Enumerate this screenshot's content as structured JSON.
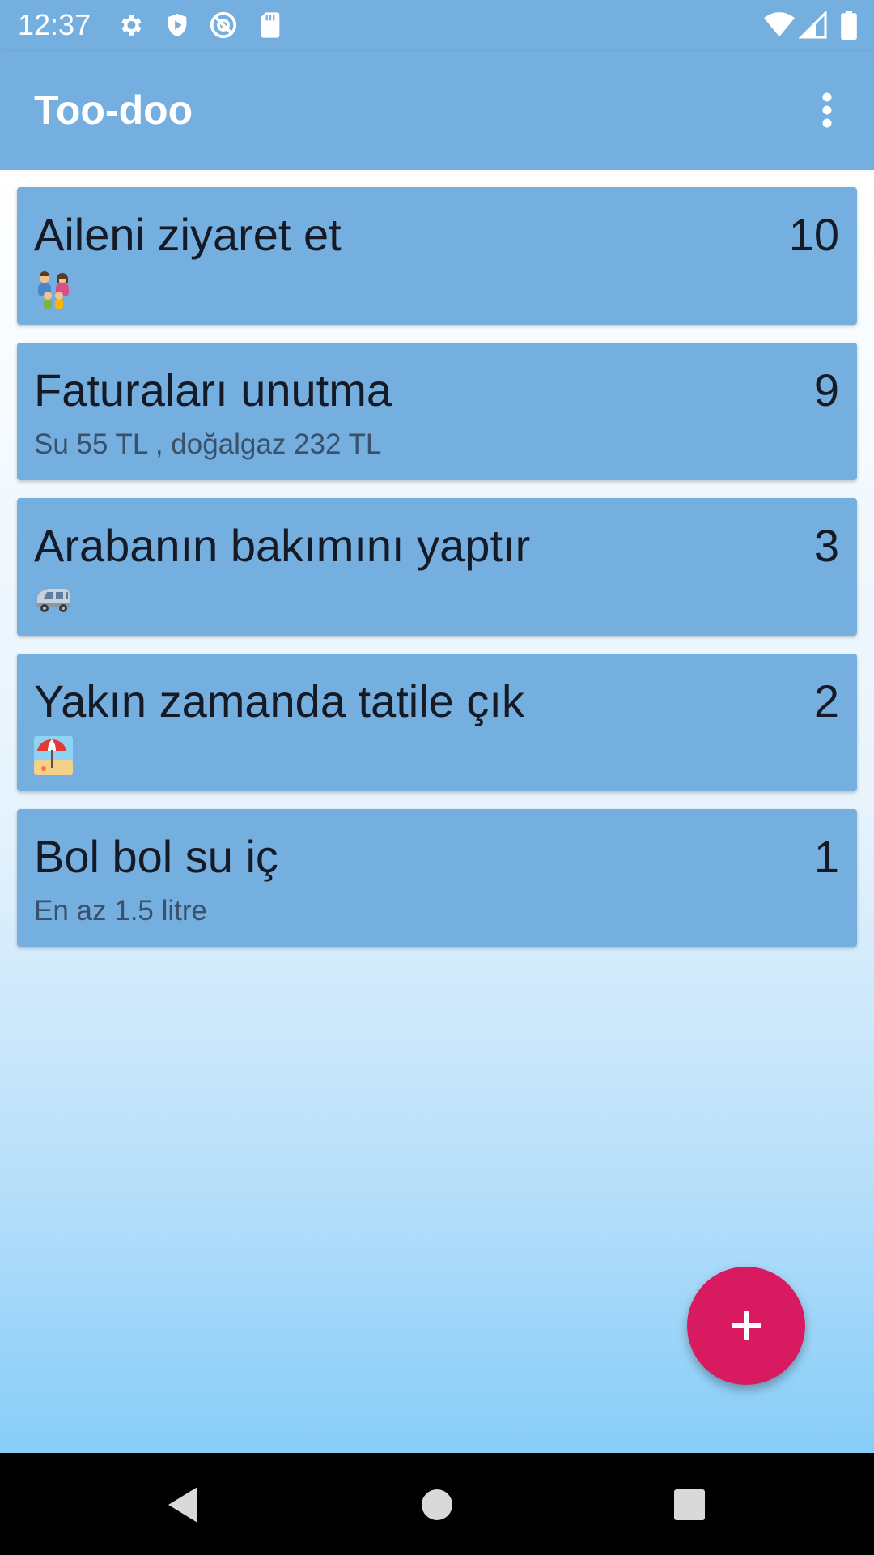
{
  "status_bar": {
    "time": "12:37"
  },
  "app_bar": {
    "title": "Too-doo"
  },
  "todos": [
    {
      "title": "Aileni ziyaret et",
      "priority": "10",
      "emoji": "family-emoji"
    },
    {
      "title": "Faturaları unutma",
      "priority": "9",
      "subtitle": "Su 55 TL , doğalgaz 232 TL"
    },
    {
      "title": "Arabanın bakımını yaptır",
      "priority": "3",
      "emoji": "car-emoji"
    },
    {
      "title": "Yakın zamanda tatile çık",
      "priority": "2",
      "emoji": "beach-umbrella-emoji"
    },
    {
      "title": "Bol bol su iç",
      "priority": "1",
      "subtitle": "En az 1.5 litre"
    }
  ],
  "colors": {
    "primary": "#74afe0",
    "accent": "#d81b60",
    "card_text": "#161a24"
  }
}
